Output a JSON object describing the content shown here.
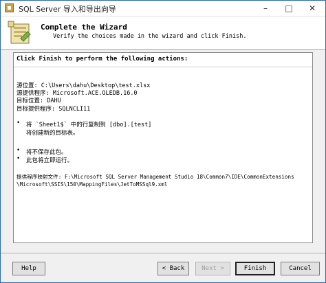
{
  "window": {
    "title": "SQL Server 导入和导出向导",
    "minimize_glyph": "–",
    "maximize_glyph": "□",
    "close_glyph": "✕"
  },
  "header": {
    "title": "Complete the Wizard",
    "subtitle": "Verify the choices made in the wizard and click Finish.",
    "icon": "wizard-icon"
  },
  "content": {
    "intro": "Click Finish to perform the following actions:",
    "summary": [
      "源位置: C:\\Users\\dahu\\Desktop\\test.xlsx",
      "源提供程序: Microsoft.ACE.OLEDB.16.0",
      "目标位置: DAHU",
      "目标提供程序: SQLNCLI11"
    ],
    "copy_items": [
      "将 `Sheet1$` 中的行复制到 [dbo].[test]",
      "将创建新的目标表。"
    ],
    "package_items": [
      "将不保存此包。",
      "此包将立即运行。"
    ],
    "mapping_label": "提供程序映射文件: F:\\Microsoft SQL Server Management Studio 18\\Common7\\IDE\\CommonExtensions",
    "mapping_path": "\\Microsoft\\SSIS\\150\\MappingFiles\\JetToMSSql9.xml",
    "bullet_glyph": "•"
  },
  "buttons": {
    "help": "Help",
    "back": "< Back",
    "next": "Next >",
    "finish": "Finish",
    "cancel": "Cancel"
  },
  "colors": {
    "title_bar": "#ffffff",
    "dialog_bg": "#f0f0f0",
    "frame": "#2b6aa8"
  }
}
